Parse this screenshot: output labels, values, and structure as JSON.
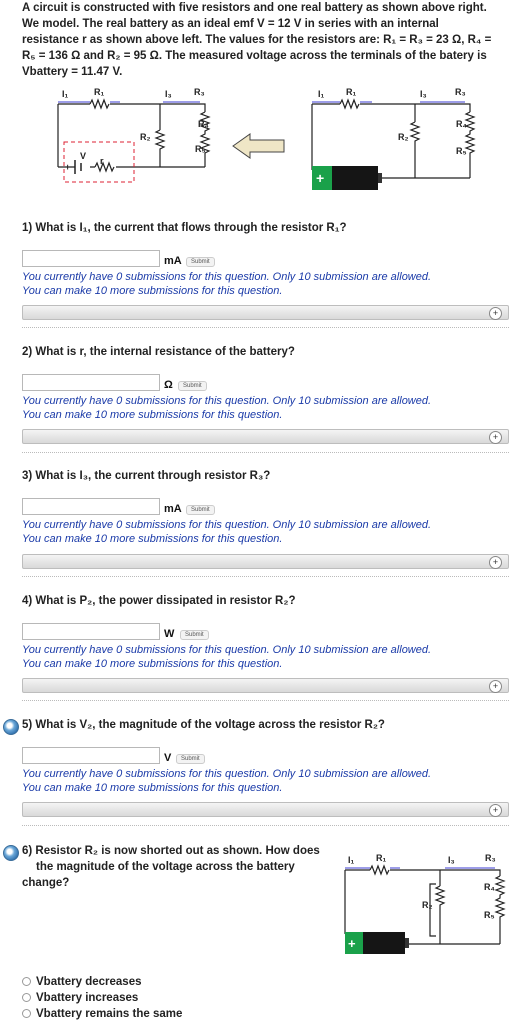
{
  "intro": {
    "line1": "A circuit is constructed with five resistors and one real battery as shown above right.",
    "line2": "We model. The real battery as an ideal emf V = 12 V in series with an internal",
    "line3": "resistance r as shown above left. The values for the resistors are: R₁ = R₃ = 23 Ω, R₄ =",
    "line4": "R₅ = 136 Ω and R₂ = 95 Ω. The measured voltage across the terminals of the batery is",
    "line5": "Vbattery = 11.47 V."
  },
  "diagram_labels": {
    "I1": "I₁",
    "R1": "R₁",
    "I3": "I₃",
    "R3": "R₃",
    "R4": "R₄",
    "R2": "R₂",
    "R5": "R₅",
    "V": "V",
    "r": "r",
    "plus": "+"
  },
  "questions": [
    {
      "text": "1) What is I₁, the current that flows through the resistor R₁?",
      "unit": "mA",
      "submit": "Submit"
    },
    {
      "text": "2) What is r, the internal resistance of the battery?",
      "unit": "Ω",
      "submit": "Submit"
    },
    {
      "text": "3) What is I₃, the current through resistor R₃?",
      "unit": "mA",
      "submit": "Submit"
    },
    {
      "text": "4) What is P₂, the power dissipated in resistor R₂?",
      "unit": "W",
      "submit": "Submit"
    },
    {
      "text": "5) What is V₂, the magnitude of the voltage across the resistor R₂?",
      "unit": "V",
      "submit": "Submit"
    }
  ],
  "submission_msg1": "You currently have 0 submissions for this question. Only 10 submission are allowed.",
  "submission_msg2": "You can make 10 more submissions for this question.",
  "q6": {
    "line1": "6) Resistor R₂ is now shorted out as shown. How does",
    "line2": "the magnitude of the voltage across the battery",
    "line3": "change?",
    "options": [
      "Vbattery decreases",
      "Vbattery increases",
      "Vbattery remains the same"
    ]
  },
  "colors": {
    "msg": "#1a3aa8",
    "wire_blue": "#3b3bd0",
    "battery_green": "#1aa14a",
    "arrow_fill": "#efe6c6"
  }
}
